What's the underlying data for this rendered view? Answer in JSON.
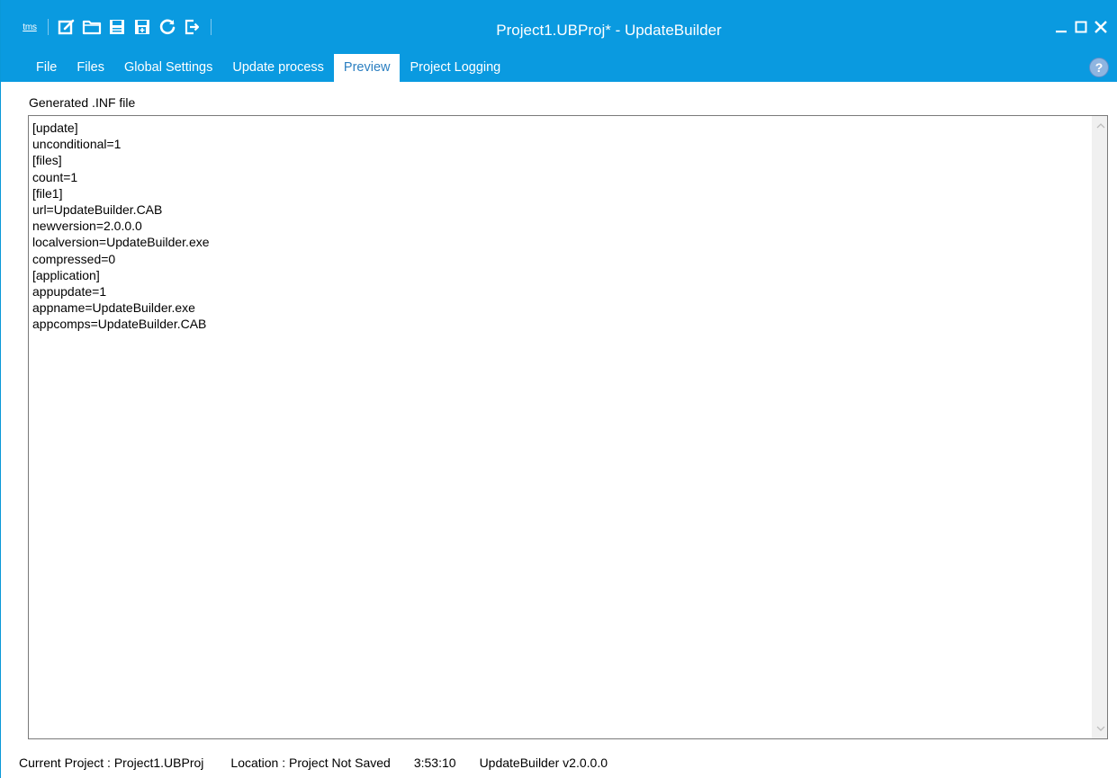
{
  "window": {
    "title": "Project1.UBProj* - UpdateBuilder",
    "logo_text": "tms",
    "accent_color": "#0a9ae0"
  },
  "quick_access_toolbar": [
    {
      "icon": "new-project-icon"
    },
    {
      "icon": "open-folder-icon"
    },
    {
      "icon": "save-icon"
    },
    {
      "icon": "save-as-icon"
    },
    {
      "icon": "refresh-icon"
    },
    {
      "icon": "exit-icon"
    }
  ],
  "tabs": [
    {
      "label": "File",
      "active": false
    },
    {
      "label": "Files",
      "active": false
    },
    {
      "label": "Global Settings",
      "active": false
    },
    {
      "label": "Update process",
      "active": false
    },
    {
      "label": "Preview",
      "active": true
    },
    {
      "label": "Project Logging",
      "active": false
    }
  ],
  "help": {
    "label": "?"
  },
  "preview": {
    "label": "Generated .INF file",
    "lines": [
      "[update]",
      "unconditional=1",
      "[files]",
      "count=1",
      "[file1]",
      "url=UpdateBuilder.CAB",
      "newversion=2.0.0.0",
      "localversion=UpdateBuilder.exe",
      "compressed=0",
      "[application]",
      "appupdate=1",
      "appname=UpdateBuilder.exe",
      "appcomps=UpdateBuilder.CAB"
    ]
  },
  "statusbar": {
    "current_project": "Current Project : Project1.UBProj",
    "location": "Location : Project Not Saved",
    "time": "3:53:10",
    "version": "UpdateBuilder v2.0.0.0"
  }
}
